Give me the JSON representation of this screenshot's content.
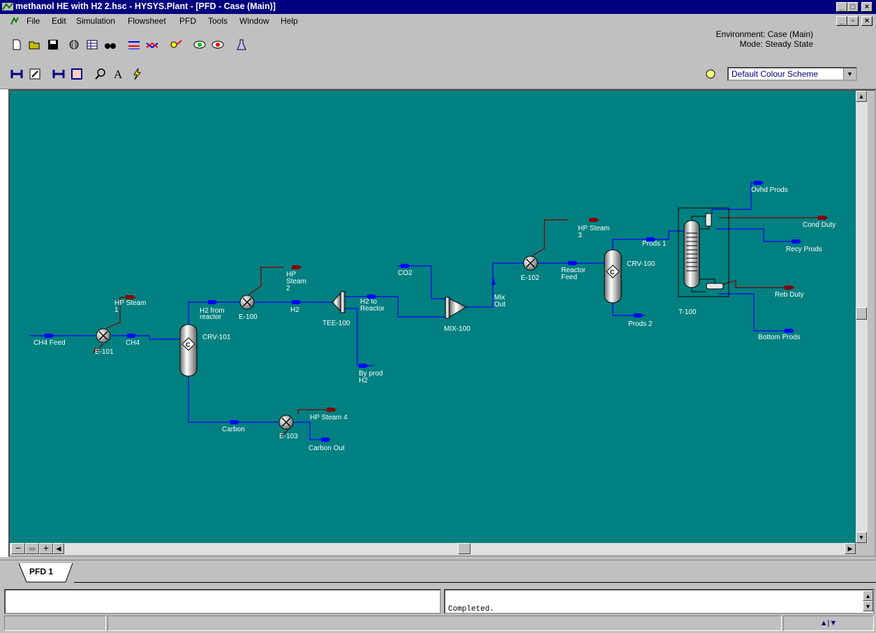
{
  "window": {
    "title": "methanol HE with H2  2.hsc - HYSYS.Plant - [PFD - Case (Main)]",
    "min": "_",
    "max": "□",
    "close": "×"
  },
  "menu": [
    "File",
    "Edit",
    "Simulation",
    "Flowsheet",
    "PFD",
    "Tools",
    "Window",
    "Help"
  ],
  "environment": {
    "line1": "Environment: Case (Main)",
    "line2": "Mode: Steady State"
  },
  "colour_scheme": {
    "value": "Default Colour Scheme"
  },
  "tabs": [
    "PFD 1"
  ],
  "status": {
    "message": "Completed."
  },
  "colors": {
    "canvas": "#008080",
    "material_stream": "#0000ff",
    "energy_stream": "#800000",
    "label": "#ffffff"
  },
  "pfd": {
    "units": {
      "e101": "E-101",
      "crv101": "CRV-101",
      "e100": "E-100",
      "tee100": "TEE-100",
      "mix100": "MIX-100",
      "e102": "E-102",
      "crv100": "CRV-100",
      "t100": "T-100",
      "e103": "E-103"
    },
    "streams": {
      "ch4_feed": "CH4 Feed",
      "ch4": "CH4",
      "hp_steam_1a": "HP Steam",
      "hp_steam_1b": "1",
      "h2_from_reactor_a": "H2 from",
      "h2_from_reactor_b": "reactor",
      "hp_steam_2a": "HP",
      "hp_steam_2b": "Steam",
      "hp_steam_2c": "2",
      "h2": "H2",
      "h2_to_reactor_a": "H2 to",
      "h2_to_reactor_b": "Reactor",
      "by_prod_a": "By prod",
      "by_prod_b": "H2",
      "co2": "CO2",
      "mix_out_a": "Mix",
      "mix_out_b": "Out",
      "hp_steam_3a": "HP Steam",
      "hp_steam_3b": "3",
      "reactor_feed_a": "Reactor",
      "reactor_feed_b": "Feed",
      "prods1": "Prods 1",
      "prods2": "Prods 2",
      "ovhd": "Ovhd Prods",
      "cond": "Cond Duty",
      "recy": "Recy Prods",
      "reb": "Reb Duty",
      "bottom": "Bottom Prods",
      "carbon": "Carbon",
      "hp_steam_4": "HP Steam 4",
      "carbon_out": "Carbon Out"
    }
  }
}
